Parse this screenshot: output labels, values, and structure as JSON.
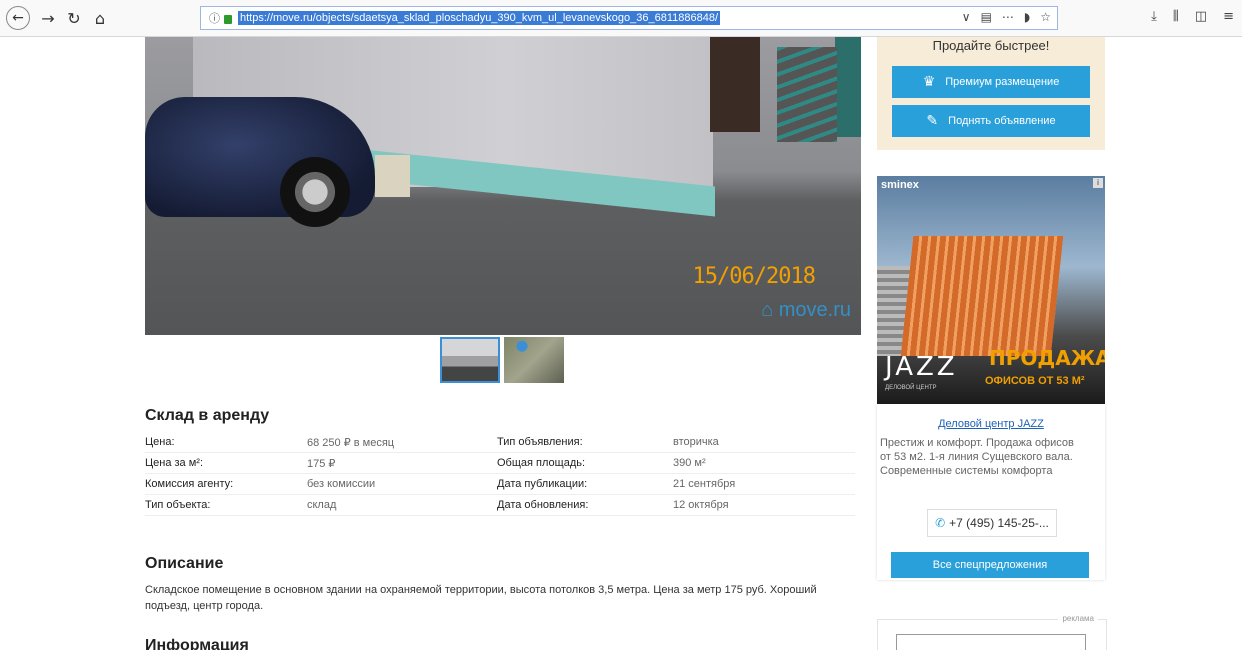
{
  "browser": {
    "url": "https://move.ru/objects/sdaetsya_sklad_ploschadyu_390_kvm_ul_levanevskogo_36_6811886848/",
    "nav_icons": [
      "back-icon",
      "forward-icon",
      "reload-icon",
      "home-icon"
    ],
    "right_icons": [
      "chevron-down-icon",
      "reader-icon",
      "more-icon",
      "pocket-icon",
      "star-icon"
    ],
    "toolbar_icons": [
      "download-icon",
      "library-icon",
      "sidebar-icon",
      "menu-icon"
    ]
  },
  "gallery": {
    "date_stamp": "15/06/2018",
    "watermark": "move.ru",
    "thumbnails": [
      "photo",
      "map"
    ]
  },
  "listing": {
    "title": "Склад в аренду",
    "rows": [
      {
        "label1": "Цена:",
        "value1": "68 250 ₽ в месяц",
        "label2": "Тип объявления:",
        "value2": "вторичка"
      },
      {
        "label1": "Цена за м²:",
        "value1": "175 ₽",
        "label2": "Общая площадь:",
        "value2": "390 м²"
      },
      {
        "label1": "Комиссия агенту:",
        "value1": "без комиссии",
        "label2": "Дата публикации:",
        "value2": "21 сентября"
      },
      {
        "label1": "Тип объекта:",
        "value1": "склад",
        "label2": "Дата обновления:",
        "value2": "12 октября"
      }
    ],
    "description_heading": "Описание",
    "description": "Складское помещение в основном здании на охраняемой территории, высота потолков 3,5 метра. Цена за метр 175 руб. Хороший подъезд, центр города.",
    "info_heading": "Информация"
  },
  "promo": {
    "title": "Продайте быстрее!",
    "premium_button": "Премиум размещение",
    "raise_button": "Поднять объявление"
  },
  "ad": {
    "brand": "sminex",
    "jazz": "JAZZ",
    "jazz_sub": "ДЕЛОВОЙ ЦЕНТР",
    "sale": "ПРОДАЖА",
    "sale_sub": "ОФИСОВ ОТ 53 М²",
    "link": "Деловой центр JAZZ",
    "text": "Престиж и комфорт. Продажа офисов от 53 м2. 1-я линия Сущевского вала. Современные системы комфорта",
    "phone": "+7 (495) 145-25-...",
    "all_button": "Все спецпредложения",
    "bottom_label": "реклама"
  },
  "colors": {
    "accent": "#2aa0da",
    "promo_bg": "#f6ecd8",
    "link": "#1c62b8",
    "date_stamp": "#f2a000"
  }
}
